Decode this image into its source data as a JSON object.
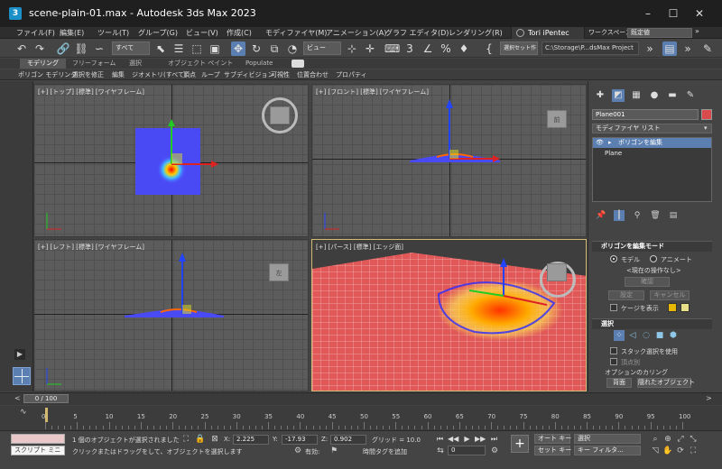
{
  "window": {
    "title": "scene-plain-01.max - Autodesk 3ds Max 2023",
    "app_icon": "3",
    "min_icon": "minimize-icon",
    "max_icon": "maximize-icon",
    "close_icon": "close-icon"
  },
  "menu": {
    "items": [
      "ファイル(F)",
      "編集(E)",
      "ツール(T)",
      "グループ(G)",
      "ビュー(V)",
      "作成(C)",
      "モディファイヤ(M)",
      "アニメーション(A)",
      "グラフ エディタ(D)",
      "レンダリング(R)"
    ],
    "user": "Tori iPentec",
    "workspace_label": "ワークスペース:",
    "workspace_value": "既定値"
  },
  "toolbar": {
    "filter_select": "すべて",
    "view_select": "ビュー",
    "selection_set": "選択セット作",
    "project_path": "C:\\Storage\\P...dsMax Project",
    "undo": "↶",
    "redo": "↷"
  },
  "ribbon": {
    "tabs": [
      "モデリング",
      "フリーフォーム",
      "選択",
      "オブジェクト ペイント",
      "Populate"
    ],
    "row": [
      "ポリゴン モデリング",
      "選択を修正",
      "編集",
      "ジオメトリ(すべて)",
      "頂点",
      "ループ",
      "サブディビジョン",
      "可視性",
      "位置合わせ",
      "プロパティ"
    ]
  },
  "viewports": {
    "top": {
      "label": "[+] [トップ] [標準] [ワイヤフレーム]"
    },
    "front": {
      "label": "[+] [フロント] [標準] [ワイヤフレーム]",
      "cube": "前"
    },
    "left": {
      "label": "[+] [レフト] [標準] [ワイヤフレーム]",
      "cube": "左"
    },
    "persp": {
      "label": "[+] [パース] [標準] [エッジ面]"
    }
  },
  "command_panel": {
    "object_name": "Plane001",
    "object_color": "#d94a4a",
    "modifier_list": "モディファイヤ リスト",
    "stack": [
      "ポリゴンを編集",
      "Plane"
    ],
    "rollout_mode": "ポリゴンを編集モード",
    "radio_model": "モデル",
    "radio_anim": "アニメート",
    "no_op": "<現在の操作なし>",
    "commit": "確認",
    "settings": "設定",
    "cancel": "キャンセル",
    "show_cage": "ケージを表示",
    "cage_color1": "#e8b800",
    "cage_color2": "#e8e088",
    "rollout_select": "選択",
    "stack_select": "スタック選択を使用",
    "by_vertex": "頂点別",
    "culling": "オプションのカリング",
    "backface": "背面",
    "hidden_obj": "隠れたオブジェクト"
  },
  "timeline": {
    "slider": "0 / 100",
    "ticks": [
      "0",
      "5",
      "10",
      "15",
      "20",
      "25",
      "30",
      "35",
      "40",
      "45",
      "50",
      "55",
      "60",
      "65",
      "70",
      "75",
      "80",
      "85",
      "90",
      "95",
      "100"
    ]
  },
  "status": {
    "maxscript_label": "スクリプト ミニ リス",
    "selected": "1 個のオブジェクトが選択されました",
    "hint": "クリックまたはドラッグをして、オブジェクトを選択します",
    "x_label": "X:",
    "x_value": "2.225",
    "y_label": "Y:",
    "y_value": "-17.93",
    "z_label": "Z:",
    "z_value": "0.902",
    "grid": "グリッド = 10.0",
    "enabled": "有効:",
    "add_time_tag": "時間タグを追加",
    "frame": "0",
    "auto_key": "オート キー",
    "set_key": "セット キー",
    "key_select": "選択",
    "key_filter": "キー フィルタ...",
    "key_plus": "+"
  }
}
